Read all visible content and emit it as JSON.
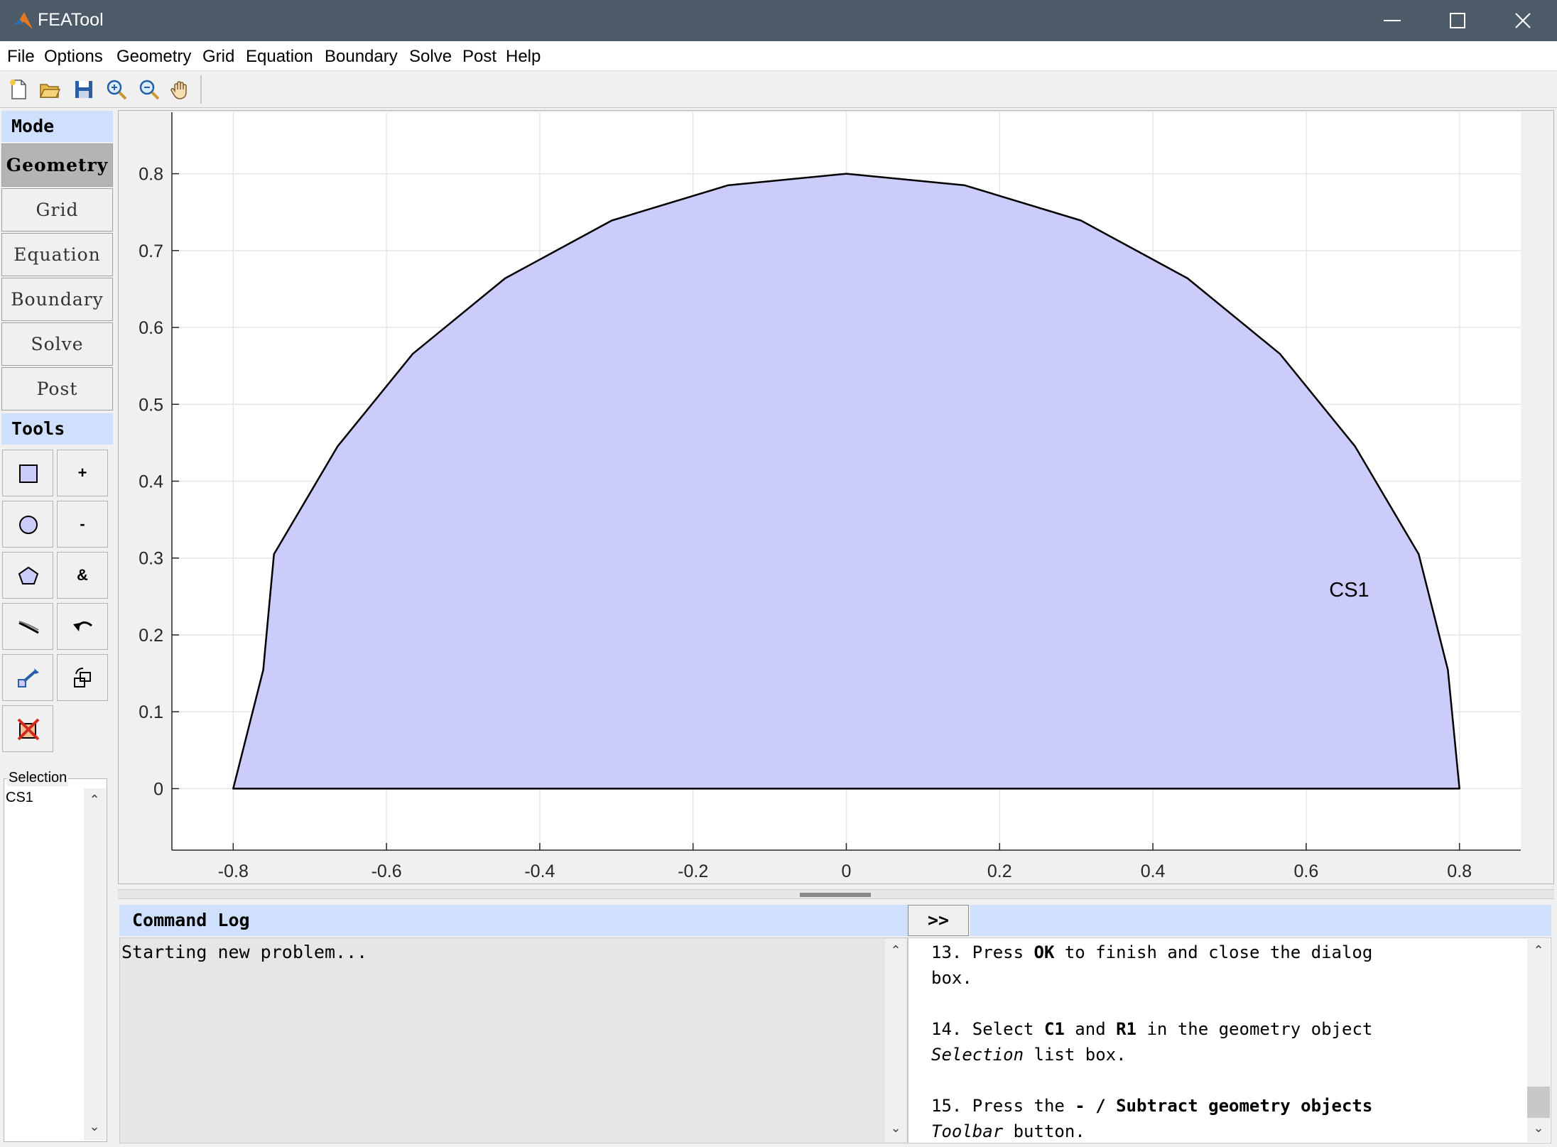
{
  "window": {
    "title": "FEATool"
  },
  "menu": [
    "File",
    "Options",
    "Geometry",
    "Grid",
    "Equation",
    "Boundary",
    "Solve",
    "Post",
    "Help"
  ],
  "toolbar": {
    "icons": [
      "new-file-icon",
      "open-folder-icon",
      "save-icon",
      "zoom-in-icon",
      "zoom-out-icon",
      "pan-hand-icon"
    ]
  },
  "mode": {
    "header": "Mode",
    "buttons": [
      "Geometry",
      "Grid",
      "Equation",
      "Boundary",
      "Solve",
      "Post"
    ],
    "active": "Geometry"
  },
  "tools": {
    "header": "Tools",
    "buttons": [
      {
        "icon": "rectangle-icon",
        "label": ""
      },
      {
        "icon": "union-icon",
        "label": "+"
      },
      {
        "icon": "circle-icon",
        "label": ""
      },
      {
        "icon": "subtract-icon",
        "label": "-"
      },
      {
        "icon": "polygon-icon",
        "label": ""
      },
      {
        "icon": "intersect-icon",
        "label": "&"
      },
      {
        "icon": "line-icon",
        "label": ""
      },
      {
        "icon": "undo-icon",
        "label": ""
      },
      {
        "icon": "edit-object-icon",
        "label": ""
      },
      {
        "icon": "transform-object-icon",
        "label": ""
      },
      {
        "icon": "delete-object-icon",
        "label": ""
      }
    ]
  },
  "selection": {
    "label": "Selection",
    "items": [
      "CS1"
    ]
  },
  "chart_data": {
    "type": "area",
    "x_ticks": [
      "-0.8",
      "-0.6",
      "-0.4",
      "-0.2",
      "0",
      "0.2",
      "0.4",
      "0.6",
      "0.8"
    ],
    "y_ticks": [
      "0",
      "0.1",
      "0.2",
      "0.3",
      "0.4",
      "0.5",
      "0.6",
      "0.7",
      "0.8"
    ],
    "xlim": [
      -0.88,
      0.88
    ],
    "ylim": [
      -0.08,
      0.88
    ],
    "grid": true,
    "fill_color": "#ccccfa",
    "stroke_color": "#000000",
    "label": {
      "text": "CS1",
      "x": 0.63,
      "y": 0.25
    },
    "polygon": [
      [
        -0.8,
        0.0
      ],
      [
        -0.7608,
        0.1545
      ],
      [
        -0.7468,
        0.305
      ],
      [
        -0.6639,
        0.4452
      ],
      [
        -0.5657,
        0.5657
      ],
      [
        -0.4452,
        0.6639
      ],
      [
        -0.3061,
        0.7391
      ],
      [
        -0.1545,
        0.7849
      ],
      [
        0.0,
        0.8
      ],
      [
        0.1545,
        0.7849
      ],
      [
        0.3061,
        0.7391
      ],
      [
        0.4452,
        0.6639
      ],
      [
        0.5657,
        0.5657
      ],
      [
        0.6639,
        0.4452
      ],
      [
        0.7468,
        0.305
      ],
      [
        0.7849,
        0.1545
      ],
      [
        0.8,
        0.0
      ]
    ]
  },
  "command_log": {
    "header": "Command Log",
    "run_label": ">>",
    "text": "Starting new problem..."
  },
  "help": {
    "lines": [
      [
        {
          "t": "13. Press "
        },
        {
          "t": "OK",
          "b": true
        },
        {
          "t": " to finish and close the dialog"
        }
      ],
      [
        {
          "t": "box."
        }
      ],
      [],
      [
        {
          "t": "14. Select "
        },
        {
          "t": "C1",
          "b": true
        },
        {
          "t": " and "
        },
        {
          "t": "R1",
          "b": true
        },
        {
          "t": " in the geometry object"
        }
      ],
      [
        {
          "t": "Selection",
          "i": true
        },
        {
          "t": " list box."
        }
      ],
      [],
      [
        {
          "t": "15. Press the "
        },
        {
          "t": "- / Subtract geometry objects",
          "b": true
        }
      ],
      [
        {
          "t": "Toolbar",
          "i": true
        },
        {
          "t": " button."
        }
      ]
    ]
  }
}
